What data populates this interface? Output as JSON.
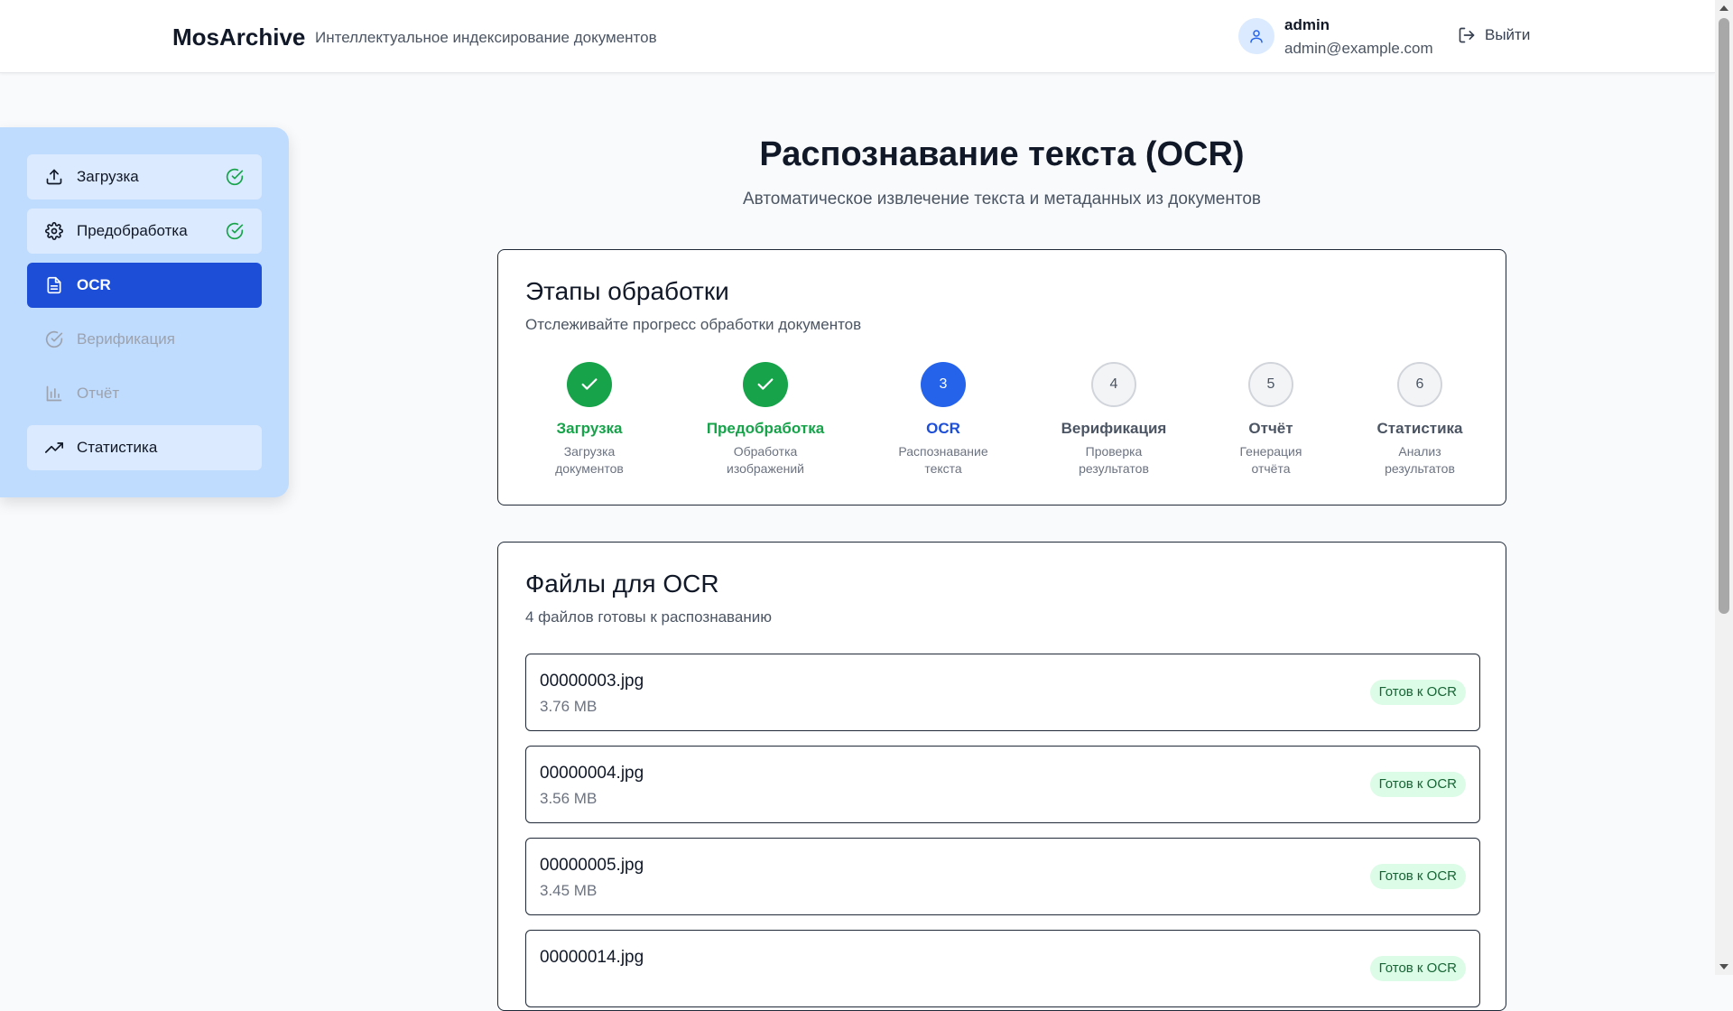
{
  "header": {
    "brand": "MosArchive",
    "tagline": "Интеллектуальное индексирование документов",
    "user_name": "admin",
    "user_email": "admin@example.com",
    "logout_label": "Выйти"
  },
  "sidebar": {
    "items": [
      {
        "label": "Загрузка",
        "state": "done",
        "icon": "upload-icon"
      },
      {
        "label": "Предобработка",
        "state": "done",
        "icon": "gear-icon"
      },
      {
        "label": "OCR",
        "state": "active",
        "icon": "document-icon"
      },
      {
        "label": "Верификация",
        "state": "disabled",
        "icon": "check-circle-icon"
      },
      {
        "label": "Отчёт",
        "state": "disabled",
        "icon": "bar-chart-icon"
      },
      {
        "label": "Статистика",
        "state": "available",
        "icon": "trending-up-icon"
      }
    ]
  },
  "main": {
    "title": "Распознавание текста (OCR)",
    "subtitle": "Автоматическое извлечение текста и метаданных из документов"
  },
  "steps_card": {
    "title": "Этапы обработки",
    "description": "Отслеживайте прогресс обработки документов",
    "steps": [
      {
        "number": "1",
        "label": "Загрузка",
        "desc": "Загрузка документов",
        "state": "done"
      },
      {
        "number": "2",
        "label": "Предобработка",
        "desc": "Обработка изображений",
        "state": "done"
      },
      {
        "number": "3",
        "label": "OCR",
        "desc": "Распознавание текста",
        "state": "current"
      },
      {
        "number": "4",
        "label": "Верификация",
        "desc": "Проверка результатов",
        "state": "pending"
      },
      {
        "number": "5",
        "label": "Отчёт",
        "desc": "Генерация отчёта",
        "state": "pending"
      },
      {
        "number": "6",
        "label": "Статистика",
        "desc": "Анализ результатов",
        "state": "pending"
      }
    ]
  },
  "files_card": {
    "title": "Файлы для OCR",
    "description": "4 файлов готовы к распознаванию",
    "files": [
      {
        "name": "00000003.jpg",
        "size": "3.76 MB",
        "status": "Готов к OCR"
      },
      {
        "name": "00000004.jpg",
        "size": "3.56 MB",
        "status": "Готов к OCR"
      },
      {
        "name": "00000005.jpg",
        "size": "3.45 MB",
        "status": "Готов к OCR"
      },
      {
        "name": "00000014.jpg",
        "size": "",
        "status": "Готов к OCR"
      }
    ]
  },
  "colors": {
    "accent": "#1d4ed8",
    "success": "#16a34a",
    "sidebar_bg": "#bfdbfe"
  }
}
